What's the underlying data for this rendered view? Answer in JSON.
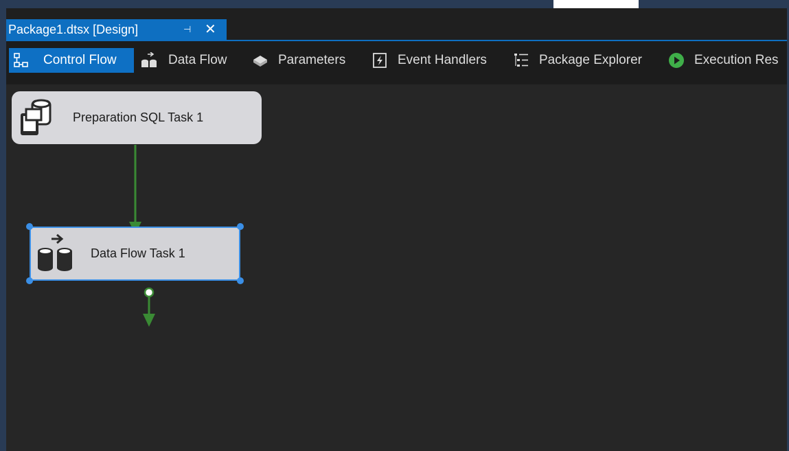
{
  "document_tab": {
    "title": "Package1.dtsx [Design]",
    "pin_glyph": "⊣",
    "close_glyph": "✕"
  },
  "toolbar": {
    "tabs": [
      {
        "label": "Control Flow",
        "icon": "control-flow-icon",
        "active": true
      },
      {
        "label": "Data Flow",
        "icon": "data-flow-icon"
      },
      {
        "label": "Parameters",
        "icon": "parameters-icon"
      },
      {
        "label": "Event Handlers",
        "icon": "event-handlers-icon"
      },
      {
        "label": "Package Explorer",
        "icon": "package-explorer-icon"
      },
      {
        "label": "Execution Res",
        "icon": "execution-results-icon"
      }
    ]
  },
  "canvas": {
    "tasks": [
      {
        "name": "Preparation SQL Task 1",
        "icon": "sql-task-icon"
      },
      {
        "name": "Data Flow Task 1",
        "icon": "data-flow-task-icon",
        "selected": true
      }
    ]
  },
  "colors": {
    "accent": "#0e70c4",
    "selection": "#3b8fe6",
    "precedence_success": "#3a8a34",
    "execution_green": "#3fae49",
    "canvas_bg": "#262626"
  }
}
